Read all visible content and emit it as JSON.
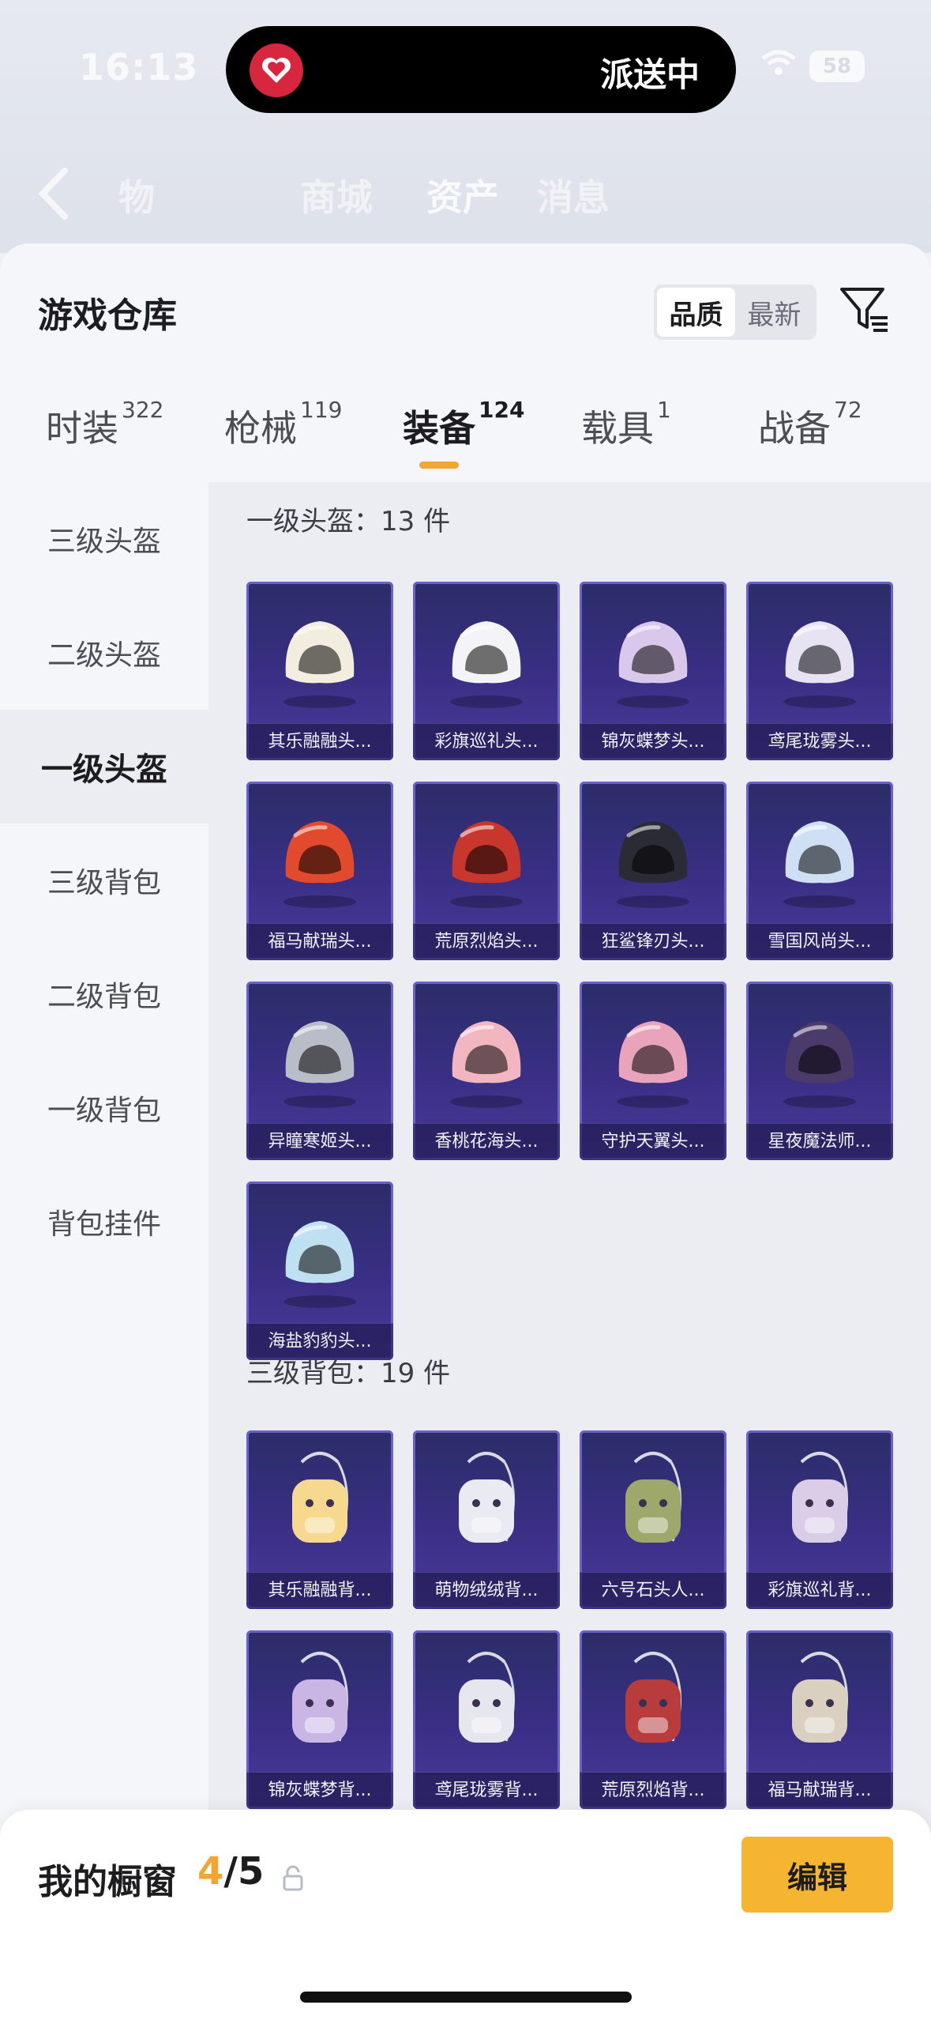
{
  "status": {
    "time": "16:13",
    "sub": "<http",
    "island_text": "派送中",
    "battery": "58"
  },
  "nav": {
    "items": [
      "物",
      "商城",
      "资产",
      "消息"
    ]
  },
  "sheet": {
    "title": "游戏仓库",
    "sort_options": [
      "品质",
      "最新"
    ],
    "active_sort": "品质"
  },
  "tabs": [
    {
      "label": "时装",
      "count": "322"
    },
    {
      "label": "枪械",
      "count": "119"
    },
    {
      "label": "装备",
      "count": "124"
    },
    {
      "label": "载具",
      "count": "1"
    },
    {
      "label": "战备",
      "count": "72"
    }
  ],
  "sidebar": {
    "items": [
      "三级头盔",
      "二级头盔",
      "一级头盔",
      "三级背包",
      "二级背包",
      "一级背包",
      "背包挂件"
    ],
    "active": "一级头盔"
  },
  "sections": [
    {
      "title": "一级头盔：13 件",
      "items": [
        "其乐融融头...",
        "彩旗巡礼头...",
        "锦灰蝶梦头...",
        "鸢尾珑雾头...",
        "福马献瑞头...",
        "荒原烈焰头...",
        "狂鲨锋刃头...",
        "雪国风尚头...",
        "异瞳寒姬头...",
        "香桃花海头...",
        "守护天翼头...",
        "星夜魔法师...",
        "海盐豹豹头..."
      ]
    },
    {
      "title": "三级背包：19 件",
      "items": [
        "其乐融融背...",
        "萌物绒绒背...",
        "六号石头人...",
        "彩旗巡礼背...",
        "锦灰蝶梦背...",
        "鸢尾珑雾背...",
        "荒原烈焰背...",
        "福马献瑞背..."
      ]
    }
  ],
  "bottom": {
    "label": "我的橱窗",
    "count_current": "4",
    "count_total": "/5",
    "edit": "编辑"
  },
  "colors": {
    "accent": "#f6b530",
    "card_bg": "#2b2d68",
    "sheet_bg": "#f5f6fa"
  }
}
